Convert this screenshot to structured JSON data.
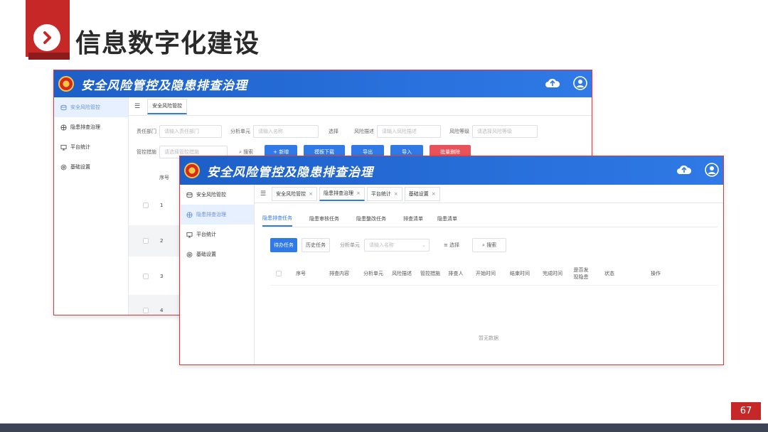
{
  "slide": {
    "title": "信息数字化建设",
    "page_number": "67"
  },
  "back_window": {
    "app_title": "安全风险管控及隐患排查治理",
    "sidebar": [
      {
        "label": "安全风险管控",
        "icon": "database-icon",
        "active": true
      },
      {
        "label": "隐患排查治理",
        "icon": "target-icon",
        "active": false
      },
      {
        "label": "平台统计",
        "icon": "monitor-icon",
        "active": false
      },
      {
        "label": "基础设置",
        "icon": "gear-icon",
        "active": false
      }
    ],
    "tabs": [
      {
        "label": "安全风险管控"
      }
    ],
    "filters": {
      "dept_label": "责任部门",
      "dept_placeholder": "请输入责任部门",
      "unit_label": "分析单元",
      "unit_placeholder": "请输入名称",
      "select_label": "选择",
      "desc_label": "风险描述",
      "desc_placeholder": "请输入风险描述",
      "level_label": "风险等级",
      "level_placeholder": "请选择风险等级",
      "measure_label": "管控措施",
      "measure_placeholder": "请选择管控措施",
      "search_label": "搜索"
    },
    "buttons": {
      "add": "+ 新增",
      "template": "模板下载",
      "export": "导出",
      "import": "导入",
      "batch_delete": "批量删除"
    },
    "table": {
      "seq_header": "序号",
      "rows": [
        "1",
        "2",
        "3",
        "4"
      ]
    }
  },
  "front_window": {
    "app_title": "安全风险管控及隐患排查治理",
    "sidebar": [
      {
        "label": "安全风险管控",
        "icon": "database-icon",
        "active": false
      },
      {
        "label": "隐患排查治理",
        "icon": "target-icon",
        "active": true
      },
      {
        "label": "平台统计",
        "icon": "monitor-icon",
        "active": false
      },
      {
        "label": "基础设置",
        "icon": "gear-icon",
        "active": false
      }
    ],
    "tabs": [
      {
        "label": "安全风险管控",
        "closable": true
      },
      {
        "label": "隐患排查治理",
        "closable": true,
        "active": true
      },
      {
        "label": "平台统计",
        "closable": true
      },
      {
        "label": "基础设置",
        "closable": true
      }
    ],
    "subtabs": [
      {
        "label": "隐患排查任务",
        "active": true
      },
      {
        "label": "隐患审核任务"
      },
      {
        "label": "隐患整改任务"
      },
      {
        "label": "排查清单"
      },
      {
        "label": "隐患清单"
      }
    ],
    "task_toggle": {
      "current": "待办任务",
      "history": "历史任务"
    },
    "filters": {
      "unit_label": "分析单元",
      "unit_placeholder": "请输入名称",
      "select_label": "选择",
      "search_label": "搜索"
    },
    "table": {
      "headers": [
        "序号",
        "排查内容",
        "分析单元",
        "风险描述",
        "管控措施",
        "排查人",
        "开始时间",
        "结束时间",
        "完成时间",
        "是否发现隐患",
        "状态",
        "操作"
      ],
      "empty_text": "暂无数据"
    }
  },
  "colors": {
    "accent_red": "#c62828",
    "header_blue": "#2f7ae6",
    "active_bg": "#e6f0ff"
  }
}
